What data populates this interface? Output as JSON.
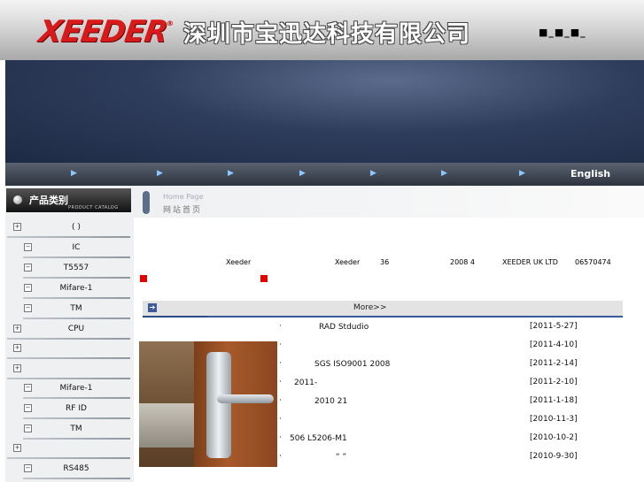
{
  "header": {
    "logo": "XEEDER",
    "registered": "®",
    "company_name": "深圳市宝迅达科技有限公司",
    "lang_switch": "■_■_■_"
  },
  "nav": {
    "items": [
      "▶",
      "▶",
      "▶",
      "▶",
      "▶",
      "▶",
      "▶"
    ],
    "english": "English"
  },
  "sidebar": {
    "title": "产品类别",
    "subtitle": "PRODUCT CATALOG",
    "categories": [
      {
        "box": "+",
        "label": "( )"
      },
      {
        "box": "−",
        "label": "IC"
      },
      {
        "box": "−",
        "label": "T5557"
      },
      {
        "box": "−",
        "label": "Mifare-1"
      },
      {
        "box": "−",
        "label": "TM"
      },
      {
        "box": "+",
        "label": "CPU"
      },
      {
        "box": "+",
        "label": ""
      },
      {
        "box": "+",
        "label": ""
      },
      {
        "box": "−",
        "label": "Mifare-1"
      },
      {
        "box": "−",
        "label": "RF ID"
      },
      {
        "box": "−",
        "label": "TM"
      },
      {
        "box": "+",
        "label": ""
      },
      {
        "box": "−",
        "label": "RS485"
      }
    ]
  },
  "breadcrumb": {
    "en": "Home Page",
    "cn": "网站首页"
  },
  "intro": {
    "p1": "Xeeder",
    "p2": "Xeeder",
    "p3": "36",
    "p4": "2008 4",
    "p5": "XEEDER UK LTD",
    "p6": "06570474"
  },
  "news": {
    "more": "More>>",
    "items": [
      {
        "title": "RAD Stdudio",
        "date": "[2011-5-27]"
      },
      {
        "title": "",
        "date": "[2011-4-10]"
      },
      {
        "title": "SGS  ISO9001 2008",
        "date": "[2011-2-14]"
      },
      {
        "title": "2011-",
        "date": "[2011-2-10]"
      },
      {
        "title": "2010     21",
        "date": "[2011-1-18]"
      },
      {
        "title": "",
        "date": "[2010-11-3]"
      },
      {
        "title": "506 L5206-M1",
        "date": "[2010-10-2]"
      },
      {
        "title": "“   ”",
        "date": "[2010-9-30]"
      }
    ]
  }
}
